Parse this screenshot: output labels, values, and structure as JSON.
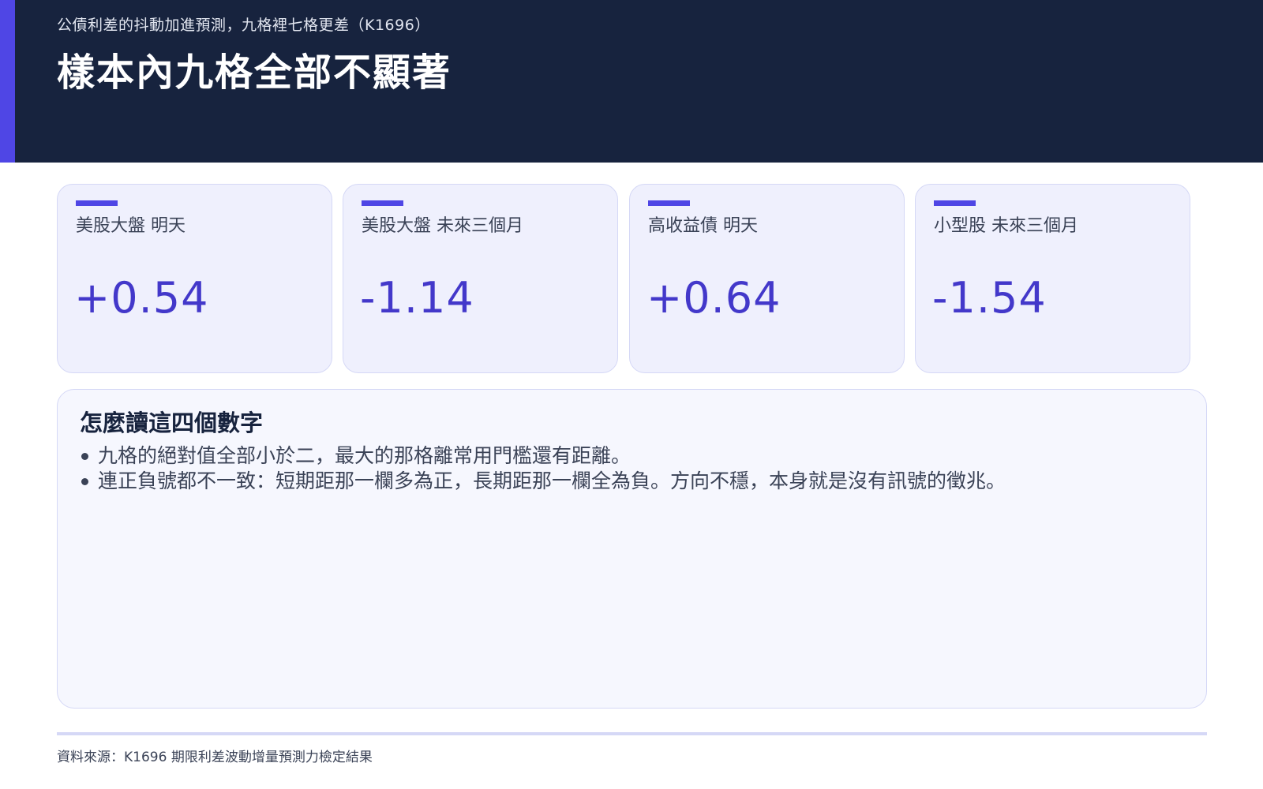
{
  "header": {
    "kicker": "公債利差的抖動加進預測，九格裡七格更差（K1696）",
    "title": "樣本內九格全部不顯著"
  },
  "cards": [
    {
      "label": "美股大盤 明天",
      "value": "+0.54"
    },
    {
      "label": "美股大盤 未來三個月",
      "value": "-1.14"
    },
    {
      "label": "高收益債 明天",
      "value": "+0.64"
    },
    {
      "label": "小型股 未來三個月",
      "value": "-1.54"
    }
  ],
  "panel": {
    "title": "怎麼讀這四個數字",
    "bullets": [
      "九格的絕對值全部小於二，最大的那格離常用門檻還有距離。",
      "連正負號都不一致：短期距那一欄多為正，長期距那一欄全為負。方向不穩，本身就是沒有訊號的徵兆。"
    ]
  },
  "footer": {
    "source": "資料來源：K1696 期限利差波動增量預測力檢定結果"
  },
  "colors": {
    "header_bg": "#17233e",
    "accent": "#4f46e5",
    "value_text": "#4338ca",
    "card_bg": "#eff0fd"
  }
}
